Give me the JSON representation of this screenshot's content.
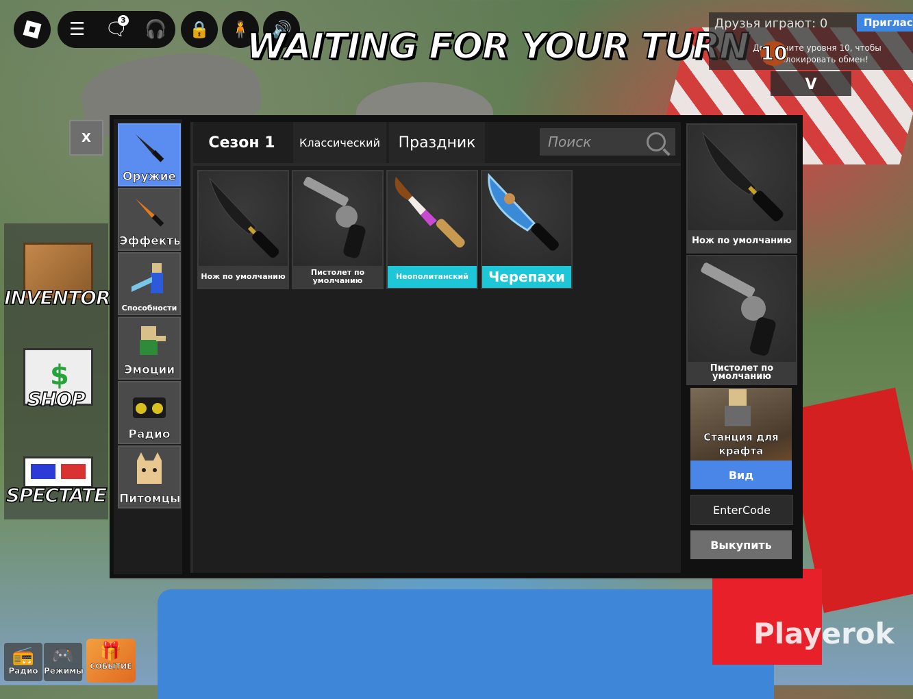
{
  "hud": {
    "chat_badge": "3",
    "title": "WAITING FOR YOUR TURN"
  },
  "friends": {
    "label": "Друзья играют: 0",
    "invite": "Пригласить",
    "unlock_text": "Достигните уровня 10, чтобы разблокировать обмен!",
    "level": "10",
    "toggle": "V"
  },
  "side_menu": {
    "inventory": "INVENTORY",
    "shop": "SHOP",
    "spectate": "SPECTATE"
  },
  "close_label": "X",
  "categories": [
    {
      "label": "Оружие",
      "icon": "knife-icon"
    },
    {
      "label": "Эффекты",
      "icon": "fire-knife-icon"
    },
    {
      "label": "Способности",
      "icon": "ability-icon"
    },
    {
      "label": "Эмоции",
      "icon": "emote-icon"
    },
    {
      "label": "Радио",
      "icon": "radio-icon"
    },
    {
      "label": "Питомцы",
      "icon": "pet-icon"
    }
  ],
  "tabs": [
    "Сезон 1",
    "Классический",
    "Праздник"
  ],
  "search": {
    "placeholder": "Поиск"
  },
  "items": [
    {
      "name": "Нож по умолчанию",
      "highlight": false,
      "icon": "knife-icon"
    },
    {
      "name": "Пистолет по умолчанию",
      "highlight": false,
      "icon": "revolver-icon"
    },
    {
      "name": "Неополитанский",
      "highlight": true,
      "icon": "neapolitan-knife-icon"
    },
    {
      "name": "Черепахи",
      "highlight": true,
      "icon": "turtle-knife-icon"
    }
  ],
  "equipped": [
    {
      "name": "Нож по умолчанию"
    },
    {
      "name": "Пистолет по умолчанию"
    }
  ],
  "craft": {
    "label": "Станция для крафта",
    "view": "Вид"
  },
  "buttons": {
    "enter_code": "EnterCode",
    "redeem": "Выкупить"
  },
  "bottom": {
    "radio": "Радио",
    "modes": "Режимы",
    "event": "СОБЫТИЕ"
  },
  "watermark": "Playerok",
  "colors": {
    "accent_blue": "#5b8df0",
    "highlight_cyan": "#1ec7d8",
    "panel": "#1e1e1e"
  }
}
